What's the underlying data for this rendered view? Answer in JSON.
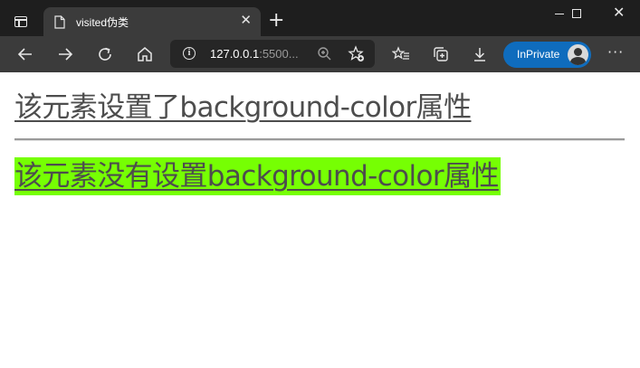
{
  "tab": {
    "title": "visited伪类",
    "close_glyph": "✕"
  },
  "new_tab_glyph": "+",
  "window": {
    "minimize_glyph": "",
    "close_glyph": "✕"
  },
  "address_bar": {
    "url_main": "127.0.0.1",
    "url_dim": ":5500..."
  },
  "toolbar": {
    "inprivate_label": "InPrivate",
    "more_glyph": "···"
  },
  "page": {
    "line1": "该元素设置了background-color属性",
    "line2": "该元素没有设置background-color属性",
    "line2_background": "#76ff03",
    "text_color": "#4d4d4d"
  },
  "colors": {
    "titlebar": "#1e1e1e",
    "toolbar": "#3b3b3b",
    "accent": "#0f6cbd"
  }
}
